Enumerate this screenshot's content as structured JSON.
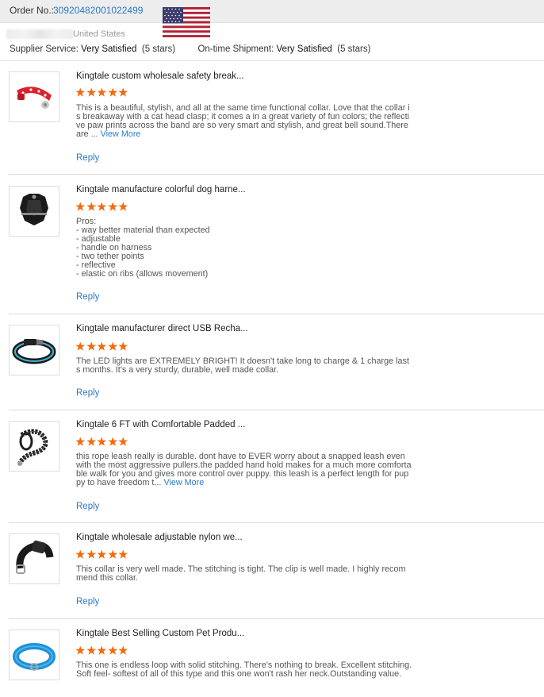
{
  "order": {
    "label": "Order No.:",
    "number": "30920482001022499"
  },
  "buyer": {
    "country": "United States",
    "flag_icon": "us-flag-icon"
  },
  "ratings": {
    "supplier_label": "Supplier Service:",
    "supplier_value": "Very Satisfied",
    "supplier_stars": "(5 stars)",
    "shipment_label": "On-time Shipment:",
    "shipment_value": "Very Satisfied",
    "shipment_stars": "(5 stars)"
  },
  "colors": {
    "link": "#2a79c9",
    "star": "#f26a10",
    "header_bg": "#ededed"
  },
  "reviews": [
    {
      "title": "Kingtale custom wholesale safety break...",
      "rating": 5,
      "text": "This is a beautiful, stylish, and all at the same time functional collar. Love that the collar is breakaway with a cat head clasp; it comes a in a great variety of fun colors; the reflective paw prints across the band are so very smart and stylish, and great bell sound.There are ...",
      "more": "View More",
      "reply": "Reply",
      "image": "red-cat-collar"
    },
    {
      "title": "Kingtale manufacture colorful dog harne...",
      "rating": 5,
      "text": "Pros:\n- way better material than expected\n- adjustable\n- handle on harness\n- two tether points\n- reflective\n- elastic on ribs (allows movement)",
      "more": "",
      "reply": "Reply",
      "image": "black-dog-harness"
    },
    {
      "title": "Kingtale manufacturer direct USB Recha...",
      "rating": 5,
      "text": "The LED lights are EXTREMELY BRIGHT! It doesn't take long to charge & 1 charge lasts months. It's a very sturdy, durable, well made collar.",
      "more": "",
      "reply": "Reply",
      "image": "led-collar"
    },
    {
      "title": "Kingtale 6 FT with Comfortable Padded ...",
      "rating": 5,
      "text": "this rope leash really is durable. dont have to EVER worry about a snapped leash even with the most aggressive pullers.the padded hand hold makes for a much more comfortable walk for you and gives more control over puppy. this leash is a perfect length for puppy to have freedom t...",
      "more": "View More",
      "reply": "Reply",
      "image": "rope-leash"
    },
    {
      "title": "Kingtale wholesale adjustable nylon we...",
      "rating": 5,
      "text": "This collar is very well made. The stitching is tight. The clip is well made. I highly recommend this collar.",
      "more": "",
      "reply": "Reply",
      "image": "black-nylon-collar"
    },
    {
      "title": "Kingtale Best Selling Custom Pet Produ...",
      "rating": 5,
      "text": "This one is endless loop with solid stitching. There's nothing to break. Excellent stitching. Soft feel- softest of all of this type and this one won't rash her neck.Outstanding value.",
      "more": "",
      "reply": "Reply",
      "image": "blue-martingale-collar"
    }
  ]
}
